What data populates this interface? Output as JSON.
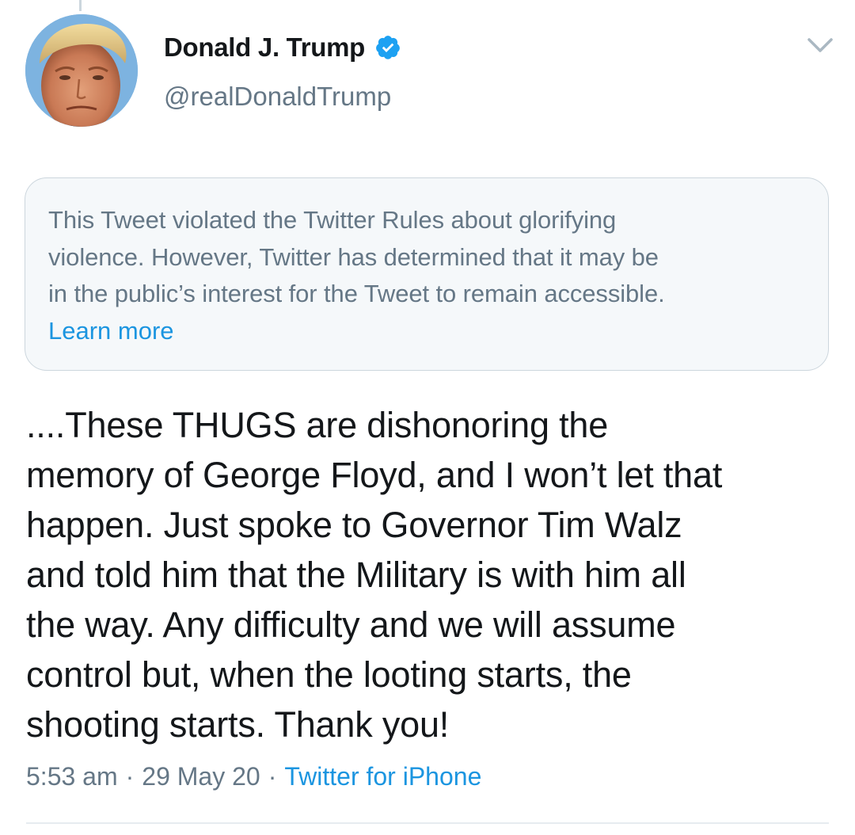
{
  "tweet": {
    "author": {
      "display_name": "Donald J. Trump",
      "handle": "@realDonaldTrump",
      "verified": true,
      "avatar_icon": "profile-photo"
    },
    "menu_icon": "chevron-down-icon",
    "notice": {
      "text": "This Tweet violated the Twitter Rules about glorifying\nviolence. However, Twitter has determined that it may be\nin the public’s interest for the Tweet to remain accessible.",
      "link_label": "Learn more"
    },
    "body": "....These THUGS are dishonoring the\nmemory of George Floyd, and I won’t let that\nhappen. Just spoke to Governor Tim Walz\nand told him that the Military is with him all\nthe way. Any difficulty and we will assume\ncontrol but, when the looting starts, the\nshooting starts. Thank you!",
    "meta": {
      "time": "5:53 am",
      "separator": "·",
      "date": "29 May 20",
      "source": "Twitter for iPhone"
    }
  },
  "colors": {
    "text_primary": "#14171a",
    "text_secondary": "#657786",
    "link": "#1b95e0",
    "verified": "#1da1f2",
    "notice_bg": "#f5f8fa",
    "border": "#ccd6dd"
  }
}
